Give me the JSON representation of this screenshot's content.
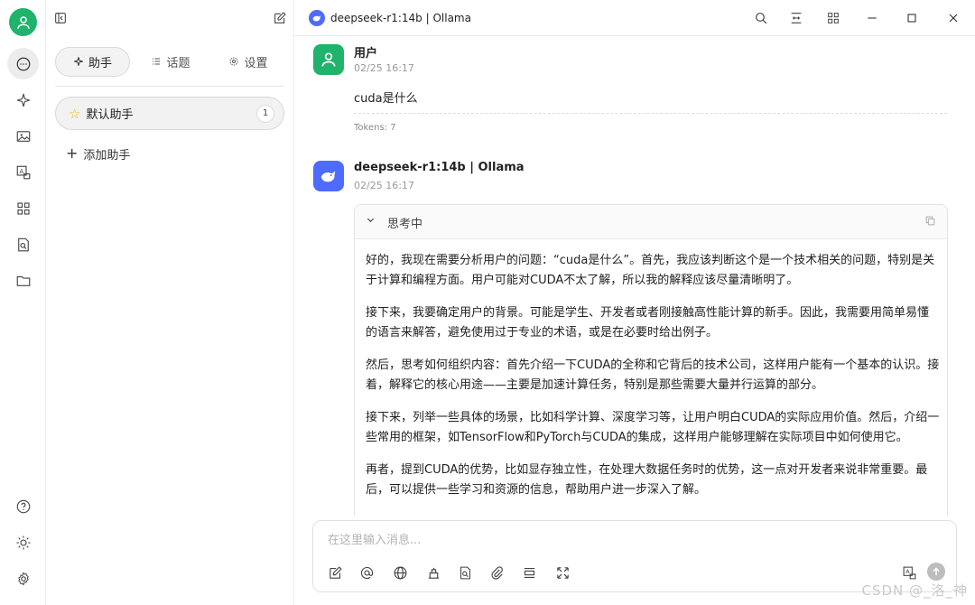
{
  "topbar": {
    "model_title": "deepseek-r1:14b | Ollama"
  },
  "panel": {
    "tabs": [
      {
        "label": "助手",
        "icon": "sparkle-icon"
      },
      {
        "label": "话题",
        "icon": "list-icon"
      },
      {
        "label": "设置",
        "icon": "gear-icon"
      }
    ],
    "assistant": {
      "name": "默认助手",
      "count": "1"
    },
    "add_assistant": "添加助手"
  },
  "messages": {
    "user": {
      "name": "用户",
      "time": "02/25 16:17",
      "text": "cuda是什么",
      "tokens": "Tokens: 7"
    },
    "assistant": {
      "name": "deepseek-r1:14b | Ollama",
      "time": "02/25 16:17",
      "thinking_label": "思考中",
      "paragraphs": [
        "好的，我现在需要分析用户的问题：“cuda是什么”。首先，我应该判断这个是一个技术相关的问题，特别是关于计算和编程方面。用户可能对CUDA不太了解，所以我的解释应该尽量清晰明了。",
        "接下来，我要确定用户的背景。可能是学生、开发者或者刚接触高性能计算的新手。因此，我需要用简单易懂的语言来解答，避免使用过于专业的术语，或是在必要时给出例子。",
        "然后，思考如何组织内容：首先介绍一下CUDA的全称和它背后的技术公司，这样用户能有一个基本的认识。接着，解释它的核心用途——主要是加速计算任务，特别是那些需要大量并行运算的部分。",
        "接下来，列举一些具体的场景，比如科学计算、深度学习等，让用户明白CUDA的实际应用价值。然后，介绍一些常用的框架，如TensorFlow和PyTorch与CUDA的集成，这样用户能够理解在实际项目中如何使用它。",
        "再者，提到CUDA的优势，比如显存独立性，在处理大数据任务时的优势，这一点对开发者来说非常重要。最后，可以提供一些学习和资源的信息，帮助用户进一步深入了解。"
      ]
    }
  },
  "input": {
    "placeholder": "在这里输入消息..."
  },
  "watermark": "CSDN @_洛_神",
  "colors": {
    "user_avatar": "#1fb36b",
    "deepseek_blue": "#4d6bfe",
    "star": "#f2b600"
  }
}
